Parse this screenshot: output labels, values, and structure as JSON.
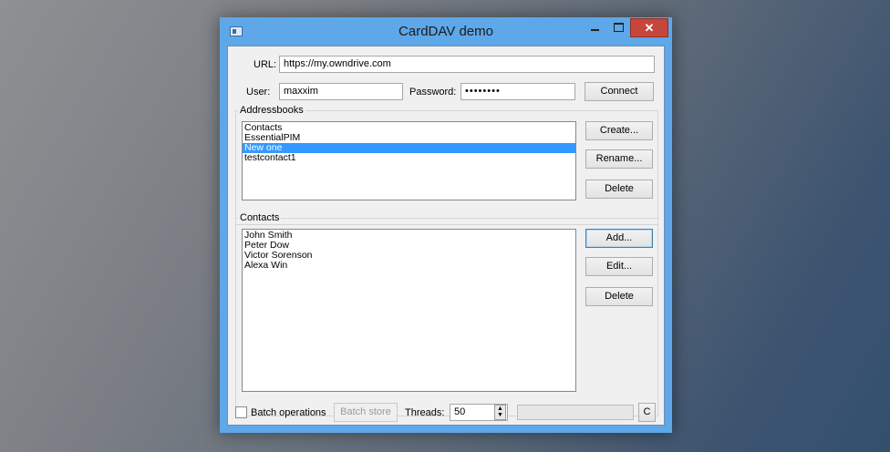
{
  "window": {
    "title": "CardDAV demo",
    "close_glyph": "✕"
  },
  "connection": {
    "url_label": "URL:",
    "url_value": "https://my.owndrive.com",
    "user_label": "User:",
    "user_value": "maxxim",
    "password_label": "Password:",
    "password_value": "••••••••",
    "connect_label": "Connect"
  },
  "addressbooks": {
    "title": "Addressbooks",
    "items": [
      {
        "label": "Contacts",
        "selected": false
      },
      {
        "label": "EssentialPIM",
        "selected": false
      },
      {
        "label": "New one",
        "selected": true
      },
      {
        "label": "testcontact1",
        "selected": false
      }
    ],
    "create_label": "Create...",
    "rename_label": "Rename...",
    "delete_label": "Delete"
  },
  "contacts": {
    "title": "Contacts",
    "items": [
      "John Smith",
      "Peter Dow",
      "Victor Sorenson",
      "Alexa Win"
    ],
    "add_label": "Add...",
    "edit_label": "Edit...",
    "delete_label": "Delete"
  },
  "footer": {
    "batch_operations_label": "Batch operations",
    "batch_operations_checked": false,
    "batch_store_label": "Batch store",
    "threads_label": "Threads:",
    "threads_value": "50",
    "progress": 0,
    "cancel_label": "C"
  },
  "colors": {
    "title_bar": "#5ea7e8",
    "close_button": "#c7463b",
    "selection": "#3399ff"
  }
}
